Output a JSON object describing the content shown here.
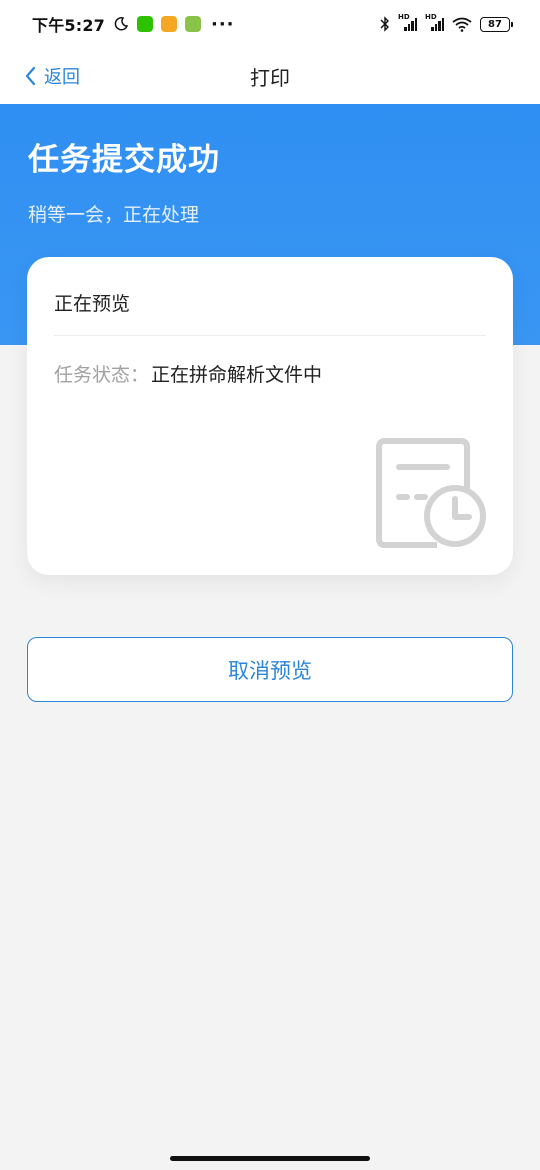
{
  "status_bar": {
    "time": "下午5:27",
    "battery": "87",
    "icons": [
      "moon-icon",
      "wechat-icon",
      "message-app-icon",
      "download-app-icon",
      "more-dots-icon",
      "bluetooth-icon",
      "hd-signal-icon",
      "hd-signal-icon",
      "wifi-icon",
      "battery-icon"
    ],
    "colors": {
      "wechat": "#2dc100",
      "message_app": "#f5a623",
      "download_app": "#8bc34a"
    }
  },
  "nav": {
    "back_label": "返回",
    "title": "打印"
  },
  "hero": {
    "title": "任务提交成功",
    "subtitle": "稍等一会，正在处理"
  },
  "card": {
    "title": "正在预览",
    "status_label": "任务状态：",
    "status_value": "正在拼命解析文件中",
    "icon": "document-clock-icon"
  },
  "actions": {
    "cancel_label": "取消预览"
  },
  "theme": {
    "accent": "#2b86d9",
    "hero_bg": "#3a96f3",
    "page_bg": "#f3f3f3"
  }
}
